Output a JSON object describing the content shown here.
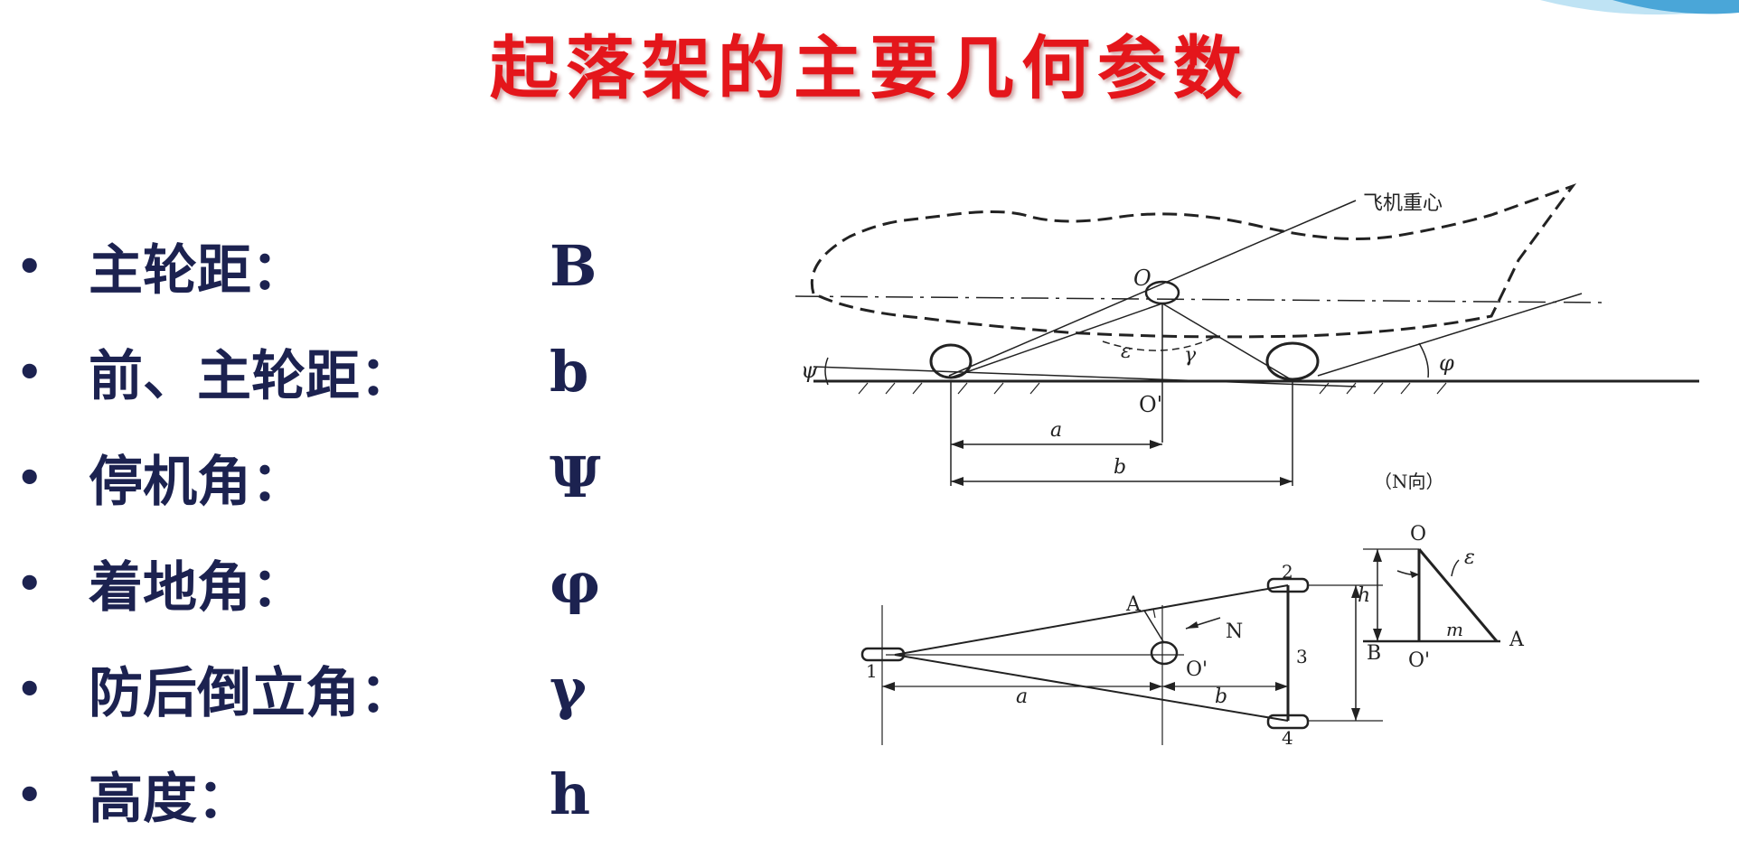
{
  "title": "起落架的主要几何参数",
  "parameters": [
    {
      "bullet": "•",
      "label": "主轮距：",
      "symbol": "B"
    },
    {
      "bullet": "•",
      "label": "前、主轮距：",
      "symbol": "b"
    },
    {
      "bullet": "•",
      "label": "停机角：",
      "symbol": "Ψ"
    },
    {
      "bullet": "•",
      "label": "着地角：",
      "symbol": "φ"
    },
    {
      "bullet": "•",
      "label": "防后倒立角：",
      "symbol": "γ"
    },
    {
      "bullet": "•",
      "label": "高度：",
      "symbol": "h"
    }
  ],
  "diagram": {
    "side_view": {
      "cg_label": "飞机重心",
      "o_label": "O",
      "o_prime_label": "O'",
      "psi_label": "ψ",
      "phi_label": "φ",
      "epsilon_label": "ε",
      "gamma_label": "γ",
      "dim_a_label": "a",
      "dim_b_label": "b"
    },
    "plan_view": {
      "wheel_1": "1",
      "wheel_2": "2",
      "wheel_3": "3",
      "wheel_4": "4",
      "a_point_label": "A",
      "n_label": "N",
      "o_prime_label": "O'",
      "dim_a_label": "a",
      "dim_b_label": "b",
      "dim_B_label": "B"
    },
    "n_view": {
      "caption": "（N向）",
      "o_label": "O",
      "o_prime_label": "O'",
      "a_label": "A",
      "h_label": "h",
      "m_label": "m",
      "epsilon_label": "ε"
    }
  }
}
